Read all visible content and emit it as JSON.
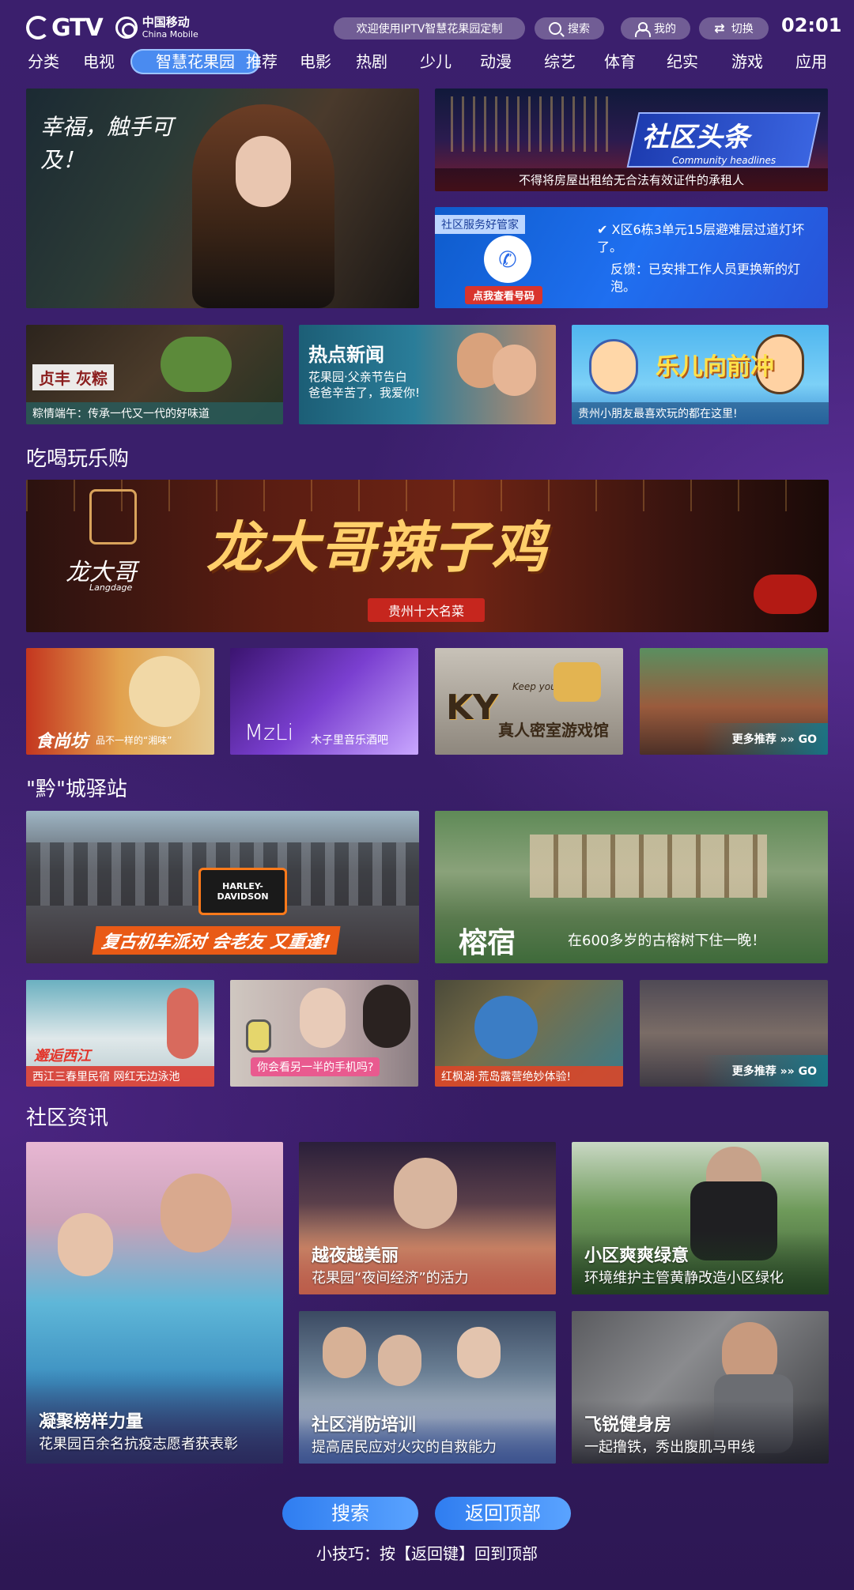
{
  "header": {
    "brand": "GTV",
    "carrier_cn": "中国移动",
    "carrier_en": "China Mobile",
    "welcome": "欢迎使用IPTV智慧花果园定制",
    "search": "搜索",
    "mine": "我的",
    "switch": "切换",
    "time": "02:01"
  },
  "nav": [
    "分类",
    "电视",
    "智慧花果园",
    "推荐",
    "电影",
    "热剧",
    "少儿",
    "动漫",
    "综艺",
    "体育",
    "纪实",
    "游戏",
    "应用"
  ],
  "hero": {
    "main_text": "幸福，触手可及！",
    "headline_tile": {
      "title": "社区头条",
      "subtitle": "Community headlines",
      "caption": "不得将房屋出租给无合法有效证件的承租人"
    },
    "service_tile": {
      "label": "社区服务好管家",
      "button": "点我查看号码",
      "item1": "X区6栋3单元15层避难层过道灯坏了。",
      "item2": "反馈：已安排工作人员更换新的灯泡。"
    }
  },
  "row2": [
    {
      "badge": "贞丰 灰粽",
      "caption": "粽情端午：传承一代又一代的好味道"
    },
    {
      "title": "热点新闻",
      "lines": [
        "花果园·父亲节告白",
        "爸爸辛苦了，我爱你!"
      ]
    },
    {
      "title": "乐儿向前冲",
      "caption": "贵州小朋友最喜欢玩的都在这里!"
    }
  ],
  "section_food": "吃喝玩乐购",
  "food_banner": {
    "brand": "龙大哥",
    "brand_en": "Langdage",
    "title": "龙大哥辣子鸡",
    "tag": "贵州十大名菜"
  },
  "food_tiles": [
    {
      "name": "食尚坊",
      "caption": "品不一样的“湘味”"
    },
    {
      "name": "MzLi",
      "caption": "木子里音乐酒吧"
    },
    {
      "name": "KY",
      "caption": "真人密室游戏馆",
      "sub": "Keep your"
    },
    {
      "caption": "更多推荐 »» GO"
    }
  ],
  "section_city": "\"黔\"城驿站",
  "city_big": [
    {
      "badge": "HARLEY-DAVIDSON",
      "caption": "复古机车派对 会老友 又重逢!"
    },
    {
      "title": "榕宿",
      "caption": "在600多岁的古榕树下住一晚！"
    }
  ],
  "city_tiles": [
    {
      "title": "邂逅西江",
      "caption": "西江三春里民宿 网红无边泳池"
    },
    {
      "caption": "你会看另一半的手机吗?"
    },
    {
      "caption": "红枫湖·荒岛露营绝妙体验!"
    },
    {
      "caption": "更多推荐 »» GO"
    }
  ],
  "section_news": "社区资讯",
  "news": [
    {
      "title": "凝聚榜样力量",
      "sub": "花果园百余名抗疫志愿者获表彰"
    },
    {
      "title": "越夜越美丽",
      "sub": "花果园“夜间经济”的活力"
    },
    {
      "title": "小区爽爽绿意",
      "sub": "环境维护主管黄静改造小区绿化"
    },
    {
      "title": "社区消防培训",
      "sub": "提高居民应对火灾的自救能力"
    },
    {
      "title": "飞锐健身房",
      "sub": "一起撸铁，秀出腹肌马甲线"
    }
  ],
  "footer": {
    "search": "搜索",
    "back_top": "返回顶部",
    "tip": "小技巧：按【返回键】回到顶部"
  }
}
